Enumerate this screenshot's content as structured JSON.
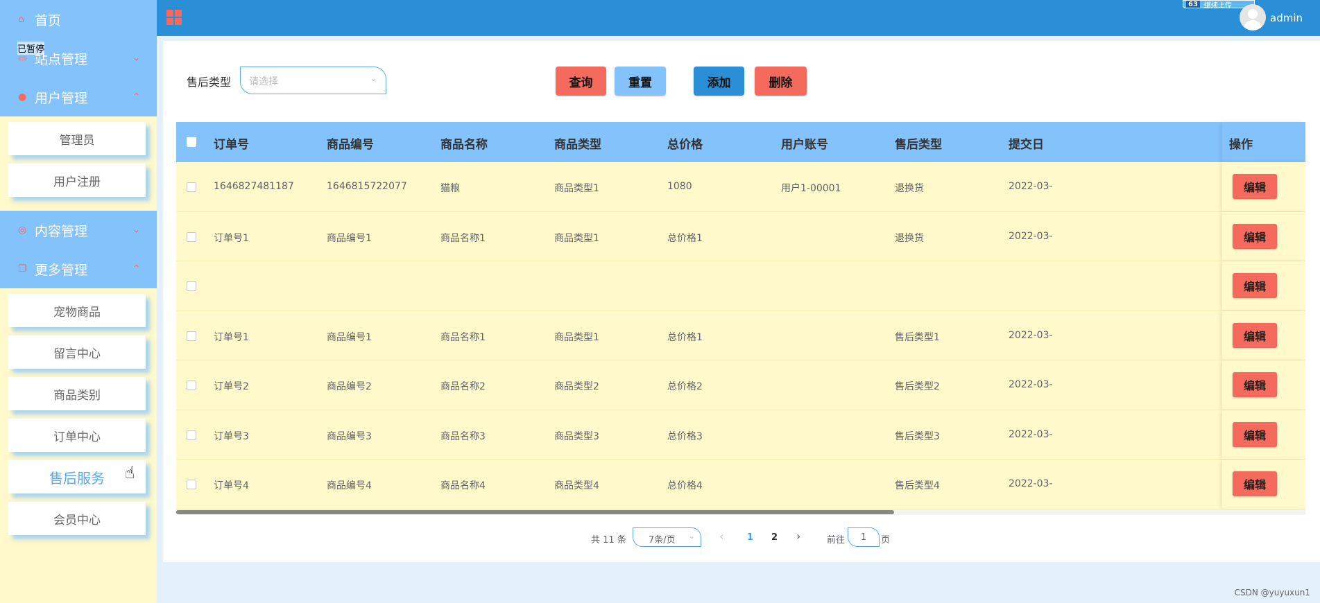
{
  "sidebar": {
    "home": "首页",
    "paused": "已暂停",
    "site": "站点管理",
    "users": "用户管理",
    "users_items": [
      "管理员",
      "用户注册"
    ],
    "content": "内容管理",
    "more": "更多管理",
    "more_items": [
      "宠物商品",
      "留言中心",
      "商品类别",
      "订单中心",
      "售后服务",
      "会员中心"
    ],
    "active_item": "售后服务"
  },
  "header": {
    "username": "admin",
    "upload_badge": "继续上传",
    "upload_badge_prefix": "63"
  },
  "filter": {
    "label": "售后类型",
    "placeholder": "请选择"
  },
  "buttons": {
    "query": "查询",
    "reset": "重置",
    "add": "添加",
    "delete": "删除"
  },
  "table": {
    "columns": [
      "订单号",
      "商品编号",
      "商品名称",
      "商品类型",
      "总价格",
      "用户账号",
      "售后类型",
      "提交日",
      "操作"
    ],
    "edit_label": "编辑",
    "rows": [
      [
        "1646827481187",
        "1646815722077",
        "猫粮",
        "商品类型1",
        "1080",
        "用户1-00001",
        "退换货",
        "2022-03-"
      ],
      [
        "订单号1",
        "商品编号1",
        "商品名称1",
        "商品类型1",
        "总价格1",
        "",
        "退换货",
        "2022-03-"
      ],
      [
        "",
        "",
        "",
        "",
        "",
        "",
        "",
        ""
      ],
      [
        "订单号1",
        "商品编号1",
        "商品名称1",
        "商品类型1",
        "总价格1",
        "",
        "售后类型1",
        "2022-03-"
      ],
      [
        "订单号2",
        "商品编号2",
        "商品名称2",
        "商品类型2",
        "总价格2",
        "",
        "售后类型2",
        "2022-03-"
      ],
      [
        "订单号3",
        "商品编号3",
        "商品名称3",
        "商品类型3",
        "总价格3",
        "",
        "售后类型3",
        "2022-03-"
      ],
      [
        "订单号4",
        "商品编号4",
        "商品名称4",
        "商品类型4",
        "总价格4",
        "",
        "售后类型4",
        "2022-03-"
      ]
    ]
  },
  "pagination": {
    "total": "共 11 条",
    "page_size": "7条/页",
    "prev": "‹",
    "pages": [
      "1",
      "2"
    ],
    "current": "1",
    "next": "›",
    "goto_label": "前往",
    "goto_value": "1",
    "goto_suffix": "页"
  },
  "watermark": "CSDN @yuyuxun1",
  "colors": {
    "accent_blue": "#2a8fd6",
    "light_blue": "#84c2fb",
    "coral": "#f46a5c",
    "cream": "#fff9cc"
  }
}
